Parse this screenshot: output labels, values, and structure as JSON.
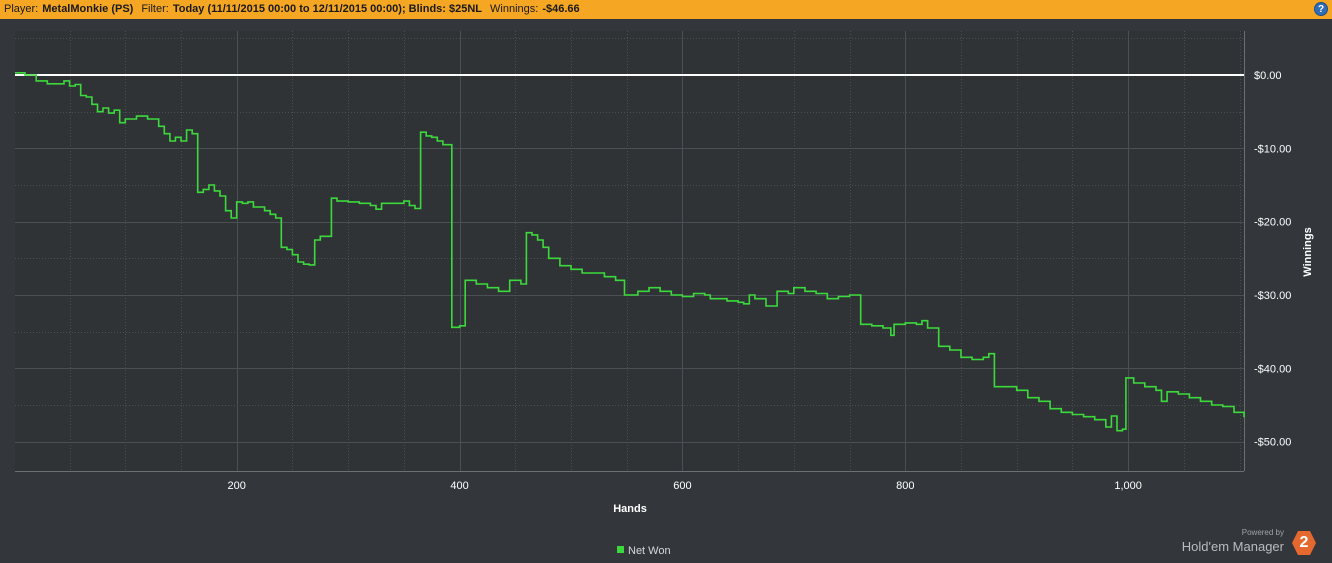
{
  "header": {
    "player_label": "Player:",
    "player_value": "MetalMonkie (PS)",
    "filter_label": "Filter:",
    "filter_value": "Today (11/11/2015 00:00 to 12/11/2015 00:00); Blinds: $25NL",
    "winnings_label": "Winnings:",
    "winnings_value": "-$46.66",
    "help_glyph": "?"
  },
  "brand": {
    "powered_by": "Powered by",
    "name": "Hold'em Manager",
    "logo_glyph": "2"
  },
  "colors": {
    "line": "#3cd93c",
    "zero_line": "#ffffff",
    "grid": "#4a4f54",
    "plot_bg": "#303336",
    "text": "#ffffff",
    "header_bg": "#f5a623"
  },
  "chart_data": {
    "type": "line",
    "xlabel": "Hands",
    "ylabel": "Winnings",
    "xlim": [
      1,
      1104
    ],
    "ylim": [
      -54,
      6
    ],
    "x_ticks": [
      200,
      400,
      600,
      800,
      1000
    ],
    "x_tick_labels": [
      "200",
      "400",
      "600",
      "800",
      "1,000"
    ],
    "y_ticks": [
      0,
      -10,
      -20,
      -30,
      -40,
      -50
    ],
    "y_tick_labels": [
      "$0.00",
      "-$10.00",
      "-$20.00",
      "-$30.00",
      "-$40.00",
      "-$50.00"
    ],
    "grid": true,
    "legend": "bottom-center",
    "reference_line": 0,
    "series": [
      {
        "name": "Net Won",
        "points": [
          [
            1,
            0.3
          ],
          [
            5,
            0.3
          ],
          [
            10,
            0
          ],
          [
            20,
            -0.8
          ],
          [
            30,
            -1.2
          ],
          [
            45,
            -0.8
          ],
          [
            50,
            -1.5
          ],
          [
            55,
            -1.3
          ],
          [
            60,
            -2.8
          ],
          [
            65,
            -3.0
          ],
          [
            70,
            -4.0
          ],
          [
            75,
            -5.0
          ],
          [
            80,
            -4.5
          ],
          [
            85,
            -5.2
          ],
          [
            90,
            -4.8
          ],
          [
            95,
            -6.5
          ],
          [
            100,
            -6.0
          ],
          [
            110,
            -5.6
          ],
          [
            120,
            -6.0
          ],
          [
            130,
            -7.0
          ],
          [
            135,
            -8.0
          ],
          [
            140,
            -9.0
          ],
          [
            145,
            -8.5
          ],
          [
            150,
            -9.0
          ],
          [
            155,
            -7.5
          ],
          [
            160,
            -8.0
          ],
          [
            165,
            -16.0
          ],
          [
            170,
            -15.6
          ],
          [
            175,
            -15.0
          ],
          [
            180,
            -15.8
          ],
          [
            185,
            -16.5
          ],
          [
            190,
            -18.5
          ],
          [
            195,
            -19.5
          ],
          [
            200,
            -17.3
          ],
          [
            205,
            -17.5
          ],
          [
            210,
            -17.3
          ],
          [
            215,
            -18.0
          ],
          [
            220,
            -18.0
          ],
          [
            225,
            -18.5
          ],
          [
            230,
            -19.0
          ],
          [
            235,
            -19.5
          ],
          [
            240,
            -23.5
          ],
          [
            245,
            -23.8
          ],
          [
            250,
            -24.5
          ],
          [
            255,
            -25.5
          ],
          [
            260,
            -25.8
          ],
          [
            265,
            -25.9
          ],
          [
            270,
            -22.5
          ],
          [
            275,
            -22.0
          ],
          [
            280,
            -22.0
          ],
          [
            285,
            -16.8
          ],
          [
            290,
            -17.2
          ],
          [
            300,
            -17.3
          ],
          [
            310,
            -17.5
          ],
          [
            320,
            -17.8
          ],
          [
            325,
            -18.3
          ],
          [
            330,
            -17.5
          ],
          [
            340,
            -17.5
          ],
          [
            350,
            -17.2
          ],
          [
            355,
            -17.8
          ],
          [
            360,
            -18.2
          ],
          [
            365,
            -7.8
          ],
          [
            370,
            -8.3
          ],
          [
            375,
            -8.5
          ],
          [
            380,
            -9.0
          ],
          [
            385,
            -9.5
          ],
          [
            390,
            -9.5
          ],
          [
            393,
            -34.4
          ],
          [
            400,
            -34.2
          ],
          [
            405,
            -28.0
          ],
          [
            415,
            -28.5
          ],
          [
            425,
            -29.0
          ],
          [
            435,
            -29.5
          ],
          [
            445,
            -28.0
          ],
          [
            455,
            -28.5
          ],
          [
            460,
            -21.5
          ],
          [
            465,
            -21.8
          ],
          [
            470,
            -22.5
          ],
          [
            475,
            -23.5
          ],
          [
            480,
            -25.0
          ],
          [
            490,
            -26.0
          ],
          [
            500,
            -26.5
          ],
          [
            510,
            -27.0
          ],
          [
            520,
            -27.0
          ],
          [
            530,
            -27.5
          ],
          [
            540,
            -28.0
          ],
          [
            548,
            -30.0
          ],
          [
            560,
            -29.5
          ],
          [
            570,
            -29.0
          ],
          [
            580,
            -29.5
          ],
          [
            590,
            -30.0
          ],
          [
            600,
            -30.2
          ],
          [
            610,
            -29.8
          ],
          [
            620,
            -30.0
          ],
          [
            625,
            -30.5
          ],
          [
            630,
            -30.5
          ],
          [
            640,
            -30.8
          ],
          [
            650,
            -31.0
          ],
          [
            655,
            -31.2
          ],
          [
            660,
            -30.0
          ],
          [
            665,
            -30.5
          ],
          [
            675,
            -31.5
          ],
          [
            680,
            -31.5
          ],
          [
            685,
            -29.5
          ],
          [
            695,
            -29.8
          ],
          [
            700,
            -29.0
          ],
          [
            710,
            -29.5
          ],
          [
            720,
            -29.8
          ],
          [
            730,
            -30.5
          ],
          [
            740,
            -30.2
          ],
          [
            750,
            -30.0
          ],
          [
            760,
            -34.0
          ],
          [
            770,
            -34.2
          ],
          [
            780,
            -34.5
          ],
          [
            787,
            -35.5
          ],
          [
            790,
            -34.0
          ],
          [
            800,
            -33.8
          ],
          [
            810,
            -34.0
          ],
          [
            815,
            -33.5
          ],
          [
            820,
            -34.5
          ],
          [
            830,
            -37.0
          ],
          [
            840,
            -37.5
          ],
          [
            850,
            -38.5
          ],
          [
            860,
            -38.8
          ],
          [
            870,
            -38.5
          ],
          [
            875,
            -38.0
          ],
          [
            880,
            -42.5
          ],
          [
            890,
            -42.5
          ],
          [
            900,
            -43.0
          ],
          [
            910,
            -44.0
          ],
          [
            920,
            -44.5
          ],
          [
            930,
            -45.5
          ],
          [
            940,
            -46.0
          ],
          [
            950,
            -46.3
          ],
          [
            960,
            -46.6
          ],
          [
            970,
            -47.0
          ],
          [
            980,
            -48.0
          ],
          [
            985,
            -46.5
          ],
          [
            990,
            -48.5
          ],
          [
            995,
            -48.3
          ],
          [
            998,
            -41.3
          ],
          [
            1005,
            -42.0
          ],
          [
            1015,
            -42.5
          ],
          [
            1025,
            -43.0
          ],
          [
            1030,
            -44.5
          ],
          [
            1035,
            -43.2
          ],
          [
            1045,
            -43.5
          ],
          [
            1055,
            -44.0
          ],
          [
            1065,
            -44.5
          ],
          [
            1075,
            -45.0
          ],
          [
            1085,
            -45.2
          ],
          [
            1095,
            -46.0
          ],
          [
            1104,
            -46.66
          ]
        ]
      }
    ]
  }
}
